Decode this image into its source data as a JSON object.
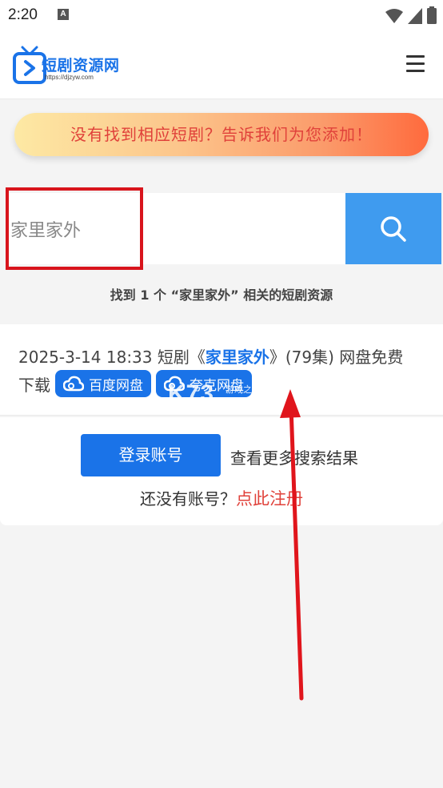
{
  "status_bar": {
    "time": "2:20",
    "a_badge": "A"
  },
  "header": {
    "logo_text": "短剧资源网",
    "logo_url": "https://djzyw.com"
  },
  "banner": {
    "text": "没有找到相应短剧？告诉我们为您添加！"
  },
  "search": {
    "value": "家里家外"
  },
  "result_count": "找到 1 个 “家里家外” 相关的短剧资源",
  "result": {
    "date": "2025-3-14 18:33",
    "prefix": "短剧《",
    "title": "家里家外",
    "suffix": "》(79集) 网盘免费",
    "line2_prefix": "下载",
    "links": [
      "百度网盘",
      "夸克网盘"
    ]
  },
  "watermark": {
    "main": "K73",
    "sub": "游戏之家",
    "domain": ".com"
  },
  "login": {
    "button": "登录账号",
    "more": "查看更多搜索结果",
    "no_account": "还没有账号？",
    "register": "点此注册"
  },
  "colors": {
    "accent": "#1a73e8",
    "search_button": "#3f9bef",
    "highlight": "#d8141c",
    "register": "#e0413a"
  }
}
